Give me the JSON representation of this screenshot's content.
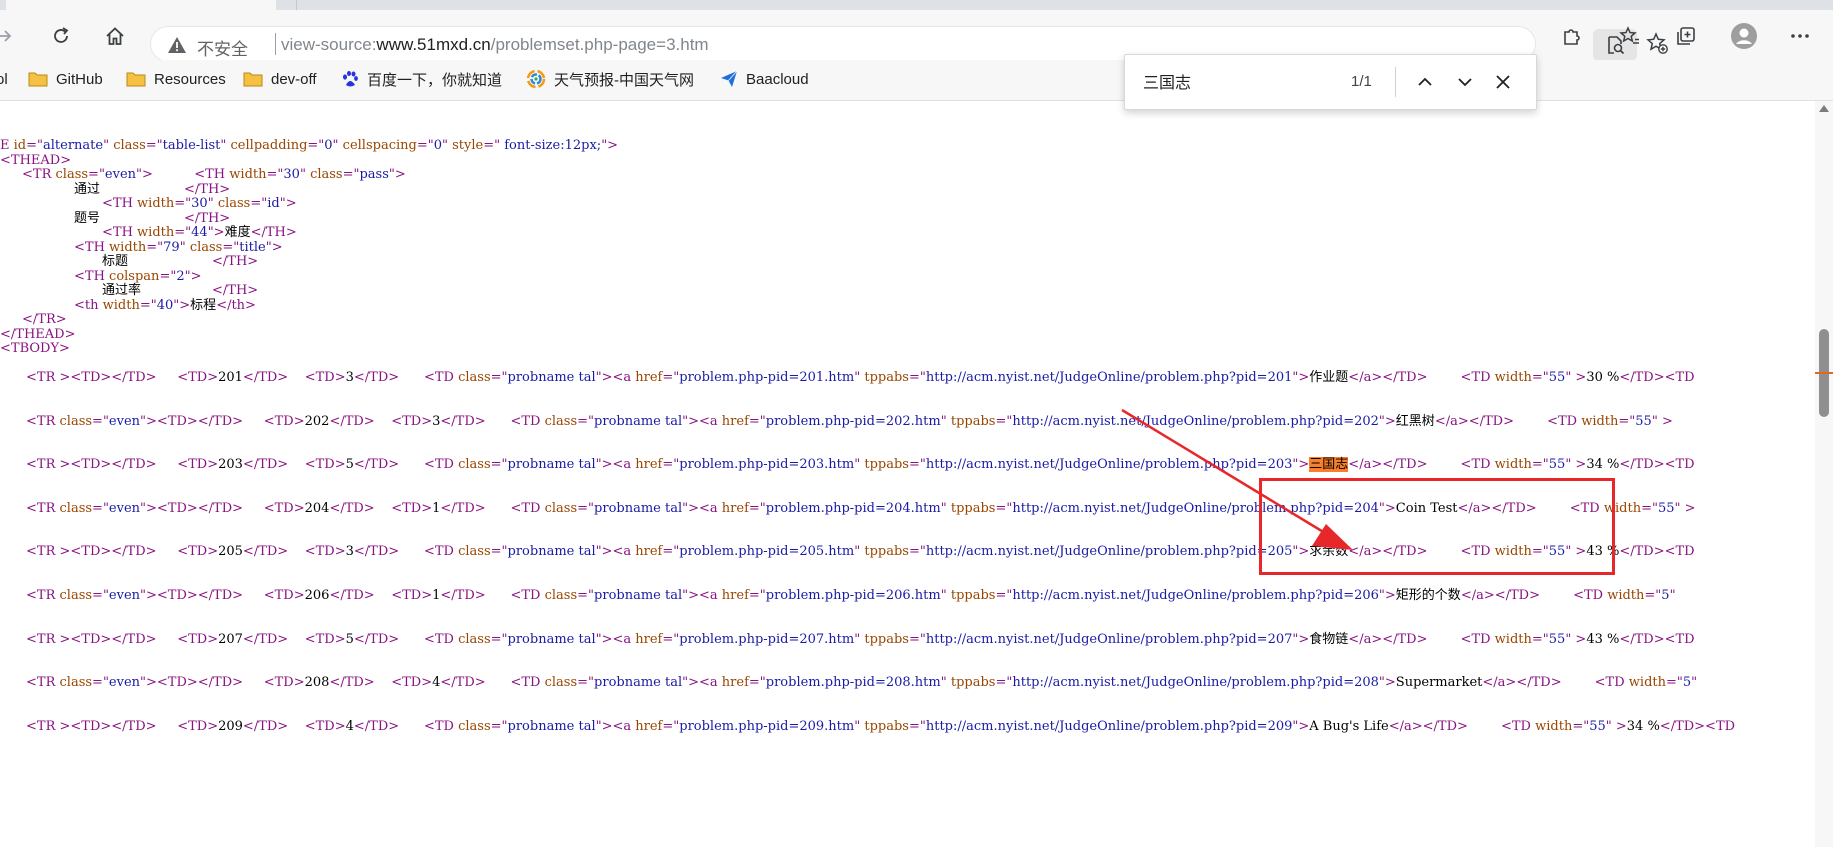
{
  "browser": {
    "address_bar": {
      "security_label": "不安全",
      "url_scheme": "view-source:",
      "url_host": "www.51mxd.cn",
      "url_path": "/problemset.php-page=3.htm"
    },
    "bookmarks": [
      {
        "label": "ol",
        "icon": "bookmark-icon"
      },
      {
        "label": "GitHub",
        "icon": "folder-icon"
      },
      {
        "label": "Resources",
        "icon": "folder-icon"
      },
      {
        "label": "dev-off",
        "icon": "folder-icon"
      },
      {
        "label": "百度一下，你就知道",
        "icon": "baidu-paw-icon"
      },
      {
        "label": "天气预报-中国天气网",
        "icon": "weather-swirl-icon"
      },
      {
        "label": "Baacloud",
        "icon": "paper-plane-icon"
      }
    ],
    "find_bar": {
      "query": "三国志",
      "count": "1/1"
    }
  },
  "colors": {
    "tag": "#881280",
    "attr_name": "#994500",
    "attr_value": "#1a1aa6",
    "match_highlight": "#f97f2c",
    "annotation": "#e8272a"
  },
  "source": {
    "header": [
      {
        "tag": "E",
        "attrs": [
          [
            "id",
            "alternate"
          ],
          [
            "class",
            "table-list"
          ],
          [
            "cellpadding",
            "0"
          ],
          [
            "cellspacing",
            "0"
          ],
          [
            "style",
            " font-size:12px;"
          ]
        ]
      },
      {
        "tag": "THEAD"
      },
      {
        "tag": "TR",
        "attrs": [
          [
            "class",
            "even"
          ]
        ],
        "suffix": "TH",
        "suffix_attrs": [
          [
            "width",
            "30"
          ],
          [
            "class",
            "pass"
          ]
        ]
      },
      {
        "text": "通过",
        "close": "/TH"
      },
      {
        "tag": "TH",
        "attrs": [
          [
            "width",
            "30"
          ],
          [
            "class",
            "id"
          ]
        ]
      },
      {
        "text": "题号",
        "close": "/TH"
      },
      {
        "tag": "TH",
        "attrs": [
          [
            "width",
            "44"
          ]
        ],
        "inline_text": "难度",
        "inline_close": "/TH"
      },
      {
        "tag": "TH",
        "attrs": [
          [
            "width",
            "79"
          ],
          [
            "class",
            "title"
          ]
        ]
      },
      {
        "text": "标题",
        "close": "/TH"
      },
      {
        "tag": "TH",
        "attrs": [
          [
            "colspan",
            "2"
          ]
        ]
      },
      {
        "text": "通过率",
        "close": "/TH"
      },
      {
        "tag": "th",
        "attrs": [
          [
            "width",
            "40"
          ]
        ],
        "inline_text": "标程",
        "inline_close": "/th"
      },
      {
        "close_only": "/TR"
      },
      {
        "close_only": "/THEAD"
      },
      {
        "tag": "TBODY"
      }
    ],
    "rows": [
      {
        "tr_class": "",
        "id": "201",
        "difficulty": "3",
        "href": "problem.php-pid=201.htm",
        "tppabs": "http://acm.nyist.net/JudgeOnline/problem.php?pid=201",
        "title": "作业题",
        "tail": "width=\"55\" >30 %</TD><TD"
      },
      {
        "tr_class": "even",
        "id": "202",
        "difficulty": "3",
        "href": "problem.php-pid=202.htm",
        "tppabs": "http://acm.nyist.net/JudgeOnline/problem.php?pid=202",
        "title": "红黑树",
        "tail": "width=\"55\" >"
      },
      {
        "tr_class": "",
        "id": "203",
        "difficulty": "5",
        "href": "problem.php-pid=203.htm",
        "tppabs": "http://acm.nyist.net/JudgeOnline/problem.php?pid=203",
        "title": "三国志",
        "tail": "width=\"55\" >34 %</TD><TD"
      },
      {
        "tr_class": "even",
        "id": "204",
        "difficulty": "1",
        "href": "problem.php-pid=204.htm",
        "tppabs": "http://acm.nyist.net/JudgeOnline/problem.php?pid=204",
        "title": "Coin Test",
        "tail": "width=\"55\" >"
      },
      {
        "tr_class": "",
        "id": "205",
        "difficulty": "3",
        "href": "problem.php-pid=205.htm",
        "tppabs": "http://acm.nyist.net/JudgeOnline/problem.php?pid=205",
        "title": "求余数",
        "tail": "width=\"55\" >43 %</TD><TD"
      },
      {
        "tr_class": "even",
        "id": "206",
        "difficulty": "1",
        "href": "problem.php-pid=206.htm",
        "tppabs": "http://acm.nyist.net/JudgeOnline/problem.php?pid=206",
        "title": "矩形的个数",
        "tail": "width=\"5"
      },
      {
        "tr_class": "",
        "id": "207",
        "difficulty": "5",
        "href": "problem.php-pid=207.htm",
        "tppabs": "http://acm.nyist.net/JudgeOnline/problem.php?pid=207",
        "title": "食物链",
        "tail": "width=\"55\" >43 %</TD><TD"
      },
      {
        "tr_class": "even",
        "id": "208",
        "difficulty": "4",
        "href": "problem.php-pid=208.htm",
        "tppabs": "http://acm.nyist.net/JudgeOnline/problem.php?pid=208",
        "title": "Supermarket",
        "tail": "width=\"5"
      },
      {
        "tr_class": "",
        "id": "209",
        "difficulty": "4",
        "href": "problem.php-pid=209.htm",
        "tppabs": "http://acm.nyist.net/JudgeOnline/problem.php?pid=209",
        "title": "A Bug's Life",
        "tail": "width=\"55\" >34 %</TD><TD"
      }
    ]
  }
}
